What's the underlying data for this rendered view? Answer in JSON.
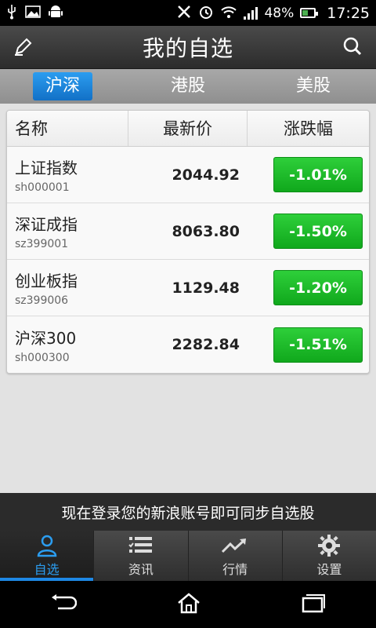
{
  "status_bar": {
    "battery_percent": "48%",
    "time": "17:25"
  },
  "header": {
    "title": "我的自选",
    "edit_icon": "pencil-icon",
    "search_icon": "search-icon"
  },
  "market_tabs": [
    {
      "label": "沪深",
      "active": true
    },
    {
      "label": "港股",
      "active": false
    },
    {
      "label": "美股",
      "active": false
    }
  ],
  "table": {
    "headers": {
      "name": "名称",
      "price": "最新价",
      "change": "涨跌幅"
    },
    "rows": [
      {
        "name": "上证指数",
        "code": "sh000001",
        "price": "2044.92",
        "change": "-1.01%"
      },
      {
        "name": "深证成指",
        "code": "sz399001",
        "price": "8063.80",
        "change": "-1.50%"
      },
      {
        "name": "创业板指",
        "code": "sz399006",
        "price": "1129.48",
        "change": "-1.20%"
      },
      {
        "name": "沪深300",
        "code": "sh000300",
        "price": "2282.84",
        "change": "-1.51%"
      }
    ]
  },
  "login_banner": "现在登录您的新浪账号即可同步自选股",
  "bottom_tabs": [
    {
      "label": "自选",
      "icon": "user-icon",
      "active": true
    },
    {
      "label": "资讯",
      "icon": "list-icon",
      "active": false
    },
    {
      "label": "行情",
      "icon": "trend-icon",
      "active": false
    },
    {
      "label": "设置",
      "icon": "gear-icon",
      "active": false
    }
  ],
  "colors": {
    "accent_blue": "#1e88e5",
    "down_green": "#10a81c"
  }
}
